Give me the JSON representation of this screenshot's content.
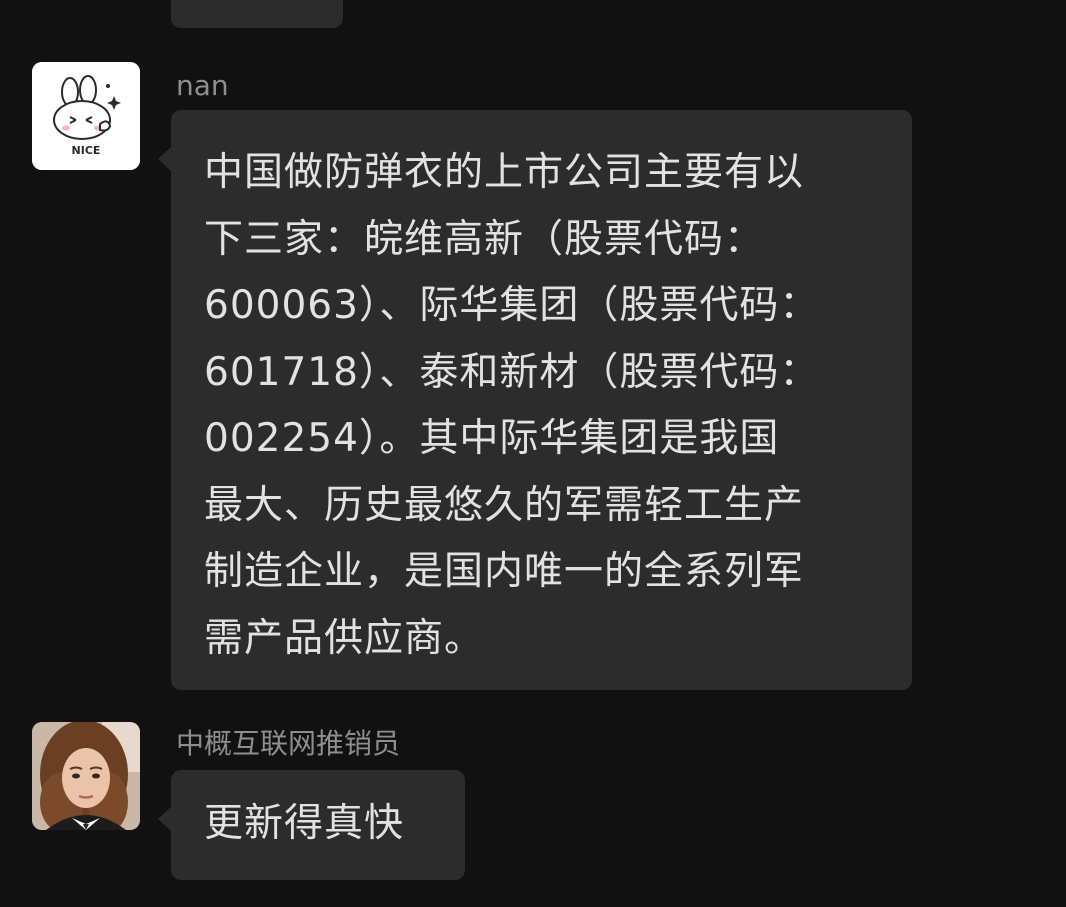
{
  "conversation": {
    "messages": [
      {
        "sender": "nan",
        "avatar_icon": "bunny-nice-sticker-avatar",
        "avatar_caption": "NICE",
        "text": "中国做防弹衣的上市公司主要有以\n下三家：皖维高新（股票代码：\n600063）、际华集团（股票代码：\n601718）、泰和新材（股票代码：\n002254）。其中际华集团是我国\n最大、历史最悠久的军需轻工生产\n制造企业，是国内唯一的全系列军\n需产品供应商。"
      },
      {
        "sender": "中概互联网推销员",
        "avatar_icon": "girl-portrait-avatar",
        "text": "更新得真快"
      }
    ]
  },
  "colors": {
    "background": "#111111",
    "bubble": "#2c2c2c",
    "bubble_text": "#e2e2e2",
    "sender_name": "#8e8e8e"
  }
}
